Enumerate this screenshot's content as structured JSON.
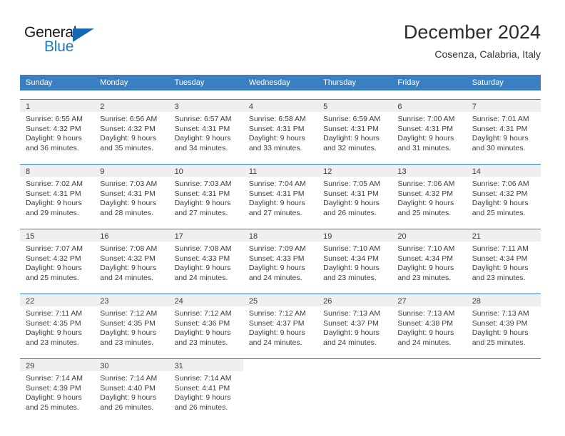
{
  "brand": {
    "name_part1": "General",
    "name_part2": "Blue",
    "flag_color": "#1668b3",
    "blue_text_color": "#1f7ac4"
  },
  "header": {
    "title": "December 2024",
    "subtitle": "Cosenza, Calabria, Italy"
  },
  "theme": {
    "header_row_bg": "#3a7fc1",
    "day_number_band_bg": "#efefef",
    "week_divider": "#3a7fc1",
    "text": "#3d3d3d"
  },
  "weekdays": [
    "Sunday",
    "Monday",
    "Tuesday",
    "Wednesday",
    "Thursday",
    "Friday",
    "Saturday"
  ],
  "weeks": [
    {
      "days": [
        {
          "num": "1",
          "sunrise": "Sunrise: 6:55 AM",
          "sunset": "Sunset: 4:32 PM",
          "daylight1": "Daylight: 9 hours",
          "daylight2": "and 36 minutes."
        },
        {
          "num": "2",
          "sunrise": "Sunrise: 6:56 AM",
          "sunset": "Sunset: 4:32 PM",
          "daylight1": "Daylight: 9 hours",
          "daylight2": "and 35 minutes."
        },
        {
          "num": "3",
          "sunrise": "Sunrise: 6:57 AM",
          "sunset": "Sunset: 4:31 PM",
          "daylight1": "Daylight: 9 hours",
          "daylight2": "and 34 minutes."
        },
        {
          "num": "4",
          "sunrise": "Sunrise: 6:58 AM",
          "sunset": "Sunset: 4:31 PM",
          "daylight1": "Daylight: 9 hours",
          "daylight2": "and 33 minutes."
        },
        {
          "num": "5",
          "sunrise": "Sunrise: 6:59 AM",
          "sunset": "Sunset: 4:31 PM",
          "daylight1": "Daylight: 9 hours",
          "daylight2": "and 32 minutes."
        },
        {
          "num": "6",
          "sunrise": "Sunrise: 7:00 AM",
          "sunset": "Sunset: 4:31 PM",
          "daylight1": "Daylight: 9 hours",
          "daylight2": "and 31 minutes."
        },
        {
          "num": "7",
          "sunrise": "Sunrise: 7:01 AM",
          "sunset": "Sunset: 4:31 PM",
          "daylight1": "Daylight: 9 hours",
          "daylight2": "and 30 minutes."
        }
      ]
    },
    {
      "days": [
        {
          "num": "8",
          "sunrise": "Sunrise: 7:02 AM",
          "sunset": "Sunset: 4:31 PM",
          "daylight1": "Daylight: 9 hours",
          "daylight2": "and 29 minutes."
        },
        {
          "num": "9",
          "sunrise": "Sunrise: 7:03 AM",
          "sunset": "Sunset: 4:31 PM",
          "daylight1": "Daylight: 9 hours",
          "daylight2": "and 28 minutes."
        },
        {
          "num": "10",
          "sunrise": "Sunrise: 7:03 AM",
          "sunset": "Sunset: 4:31 PM",
          "daylight1": "Daylight: 9 hours",
          "daylight2": "and 27 minutes."
        },
        {
          "num": "11",
          "sunrise": "Sunrise: 7:04 AM",
          "sunset": "Sunset: 4:31 PM",
          "daylight1": "Daylight: 9 hours",
          "daylight2": "and 27 minutes."
        },
        {
          "num": "12",
          "sunrise": "Sunrise: 7:05 AM",
          "sunset": "Sunset: 4:31 PM",
          "daylight1": "Daylight: 9 hours",
          "daylight2": "and 26 minutes."
        },
        {
          "num": "13",
          "sunrise": "Sunrise: 7:06 AM",
          "sunset": "Sunset: 4:32 PM",
          "daylight1": "Daylight: 9 hours",
          "daylight2": "and 25 minutes."
        },
        {
          "num": "14",
          "sunrise": "Sunrise: 7:06 AM",
          "sunset": "Sunset: 4:32 PM",
          "daylight1": "Daylight: 9 hours",
          "daylight2": "and 25 minutes."
        }
      ]
    },
    {
      "days": [
        {
          "num": "15",
          "sunrise": "Sunrise: 7:07 AM",
          "sunset": "Sunset: 4:32 PM",
          "daylight1": "Daylight: 9 hours",
          "daylight2": "and 25 minutes."
        },
        {
          "num": "16",
          "sunrise": "Sunrise: 7:08 AM",
          "sunset": "Sunset: 4:32 PM",
          "daylight1": "Daylight: 9 hours",
          "daylight2": "and 24 minutes."
        },
        {
          "num": "17",
          "sunrise": "Sunrise: 7:08 AM",
          "sunset": "Sunset: 4:33 PM",
          "daylight1": "Daylight: 9 hours",
          "daylight2": "and 24 minutes."
        },
        {
          "num": "18",
          "sunrise": "Sunrise: 7:09 AM",
          "sunset": "Sunset: 4:33 PM",
          "daylight1": "Daylight: 9 hours",
          "daylight2": "and 24 minutes."
        },
        {
          "num": "19",
          "sunrise": "Sunrise: 7:10 AM",
          "sunset": "Sunset: 4:34 PM",
          "daylight1": "Daylight: 9 hours",
          "daylight2": "and 23 minutes."
        },
        {
          "num": "20",
          "sunrise": "Sunrise: 7:10 AM",
          "sunset": "Sunset: 4:34 PM",
          "daylight1": "Daylight: 9 hours",
          "daylight2": "and 23 minutes."
        },
        {
          "num": "21",
          "sunrise": "Sunrise: 7:11 AM",
          "sunset": "Sunset: 4:34 PM",
          "daylight1": "Daylight: 9 hours",
          "daylight2": "and 23 minutes."
        }
      ]
    },
    {
      "days": [
        {
          "num": "22",
          "sunrise": "Sunrise: 7:11 AM",
          "sunset": "Sunset: 4:35 PM",
          "daylight1": "Daylight: 9 hours",
          "daylight2": "and 23 minutes."
        },
        {
          "num": "23",
          "sunrise": "Sunrise: 7:12 AM",
          "sunset": "Sunset: 4:35 PM",
          "daylight1": "Daylight: 9 hours",
          "daylight2": "and 23 minutes."
        },
        {
          "num": "24",
          "sunrise": "Sunrise: 7:12 AM",
          "sunset": "Sunset: 4:36 PM",
          "daylight1": "Daylight: 9 hours",
          "daylight2": "and 23 minutes."
        },
        {
          "num": "25",
          "sunrise": "Sunrise: 7:12 AM",
          "sunset": "Sunset: 4:37 PM",
          "daylight1": "Daylight: 9 hours",
          "daylight2": "and 24 minutes."
        },
        {
          "num": "26",
          "sunrise": "Sunrise: 7:13 AM",
          "sunset": "Sunset: 4:37 PM",
          "daylight1": "Daylight: 9 hours",
          "daylight2": "and 24 minutes."
        },
        {
          "num": "27",
          "sunrise": "Sunrise: 7:13 AM",
          "sunset": "Sunset: 4:38 PM",
          "daylight1": "Daylight: 9 hours",
          "daylight2": "and 24 minutes."
        },
        {
          "num": "28",
          "sunrise": "Sunrise: 7:13 AM",
          "sunset": "Sunset: 4:39 PM",
          "daylight1": "Daylight: 9 hours",
          "daylight2": "and 25 minutes."
        }
      ]
    },
    {
      "days": [
        {
          "num": "29",
          "sunrise": "Sunrise: 7:14 AM",
          "sunset": "Sunset: 4:39 PM",
          "daylight1": "Daylight: 9 hours",
          "daylight2": "and 25 minutes."
        },
        {
          "num": "30",
          "sunrise": "Sunrise: 7:14 AM",
          "sunset": "Sunset: 4:40 PM",
          "daylight1": "Daylight: 9 hours",
          "daylight2": "and 26 minutes."
        },
        {
          "num": "31",
          "sunrise": "Sunrise: 7:14 AM",
          "sunset": "Sunset: 4:41 PM",
          "daylight1": "Daylight: 9 hours",
          "daylight2": "and 26 minutes."
        },
        {
          "num": "",
          "sunrise": "",
          "sunset": "",
          "daylight1": "",
          "daylight2": ""
        },
        {
          "num": "",
          "sunrise": "",
          "sunset": "",
          "daylight1": "",
          "daylight2": ""
        },
        {
          "num": "",
          "sunrise": "",
          "sunset": "",
          "daylight1": "",
          "daylight2": ""
        },
        {
          "num": "",
          "sunrise": "",
          "sunset": "",
          "daylight1": "",
          "daylight2": ""
        }
      ]
    }
  ]
}
